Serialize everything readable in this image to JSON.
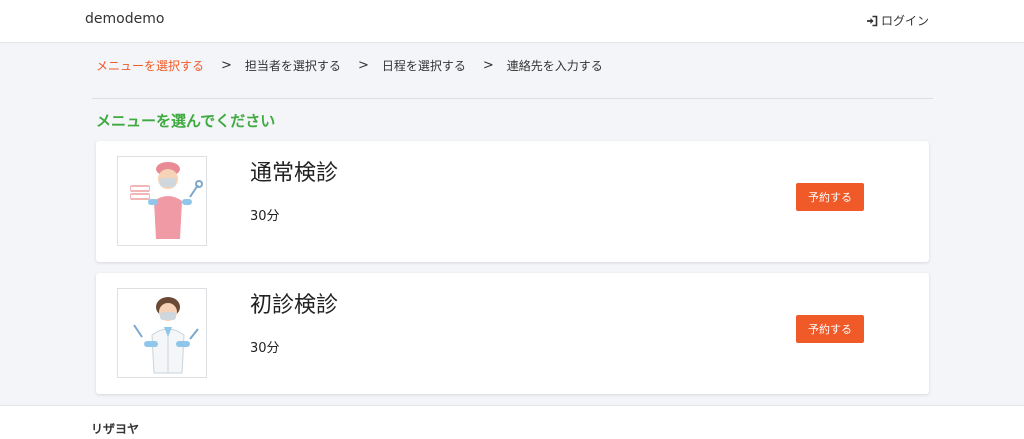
{
  "navbar": {
    "brand": "demodemo",
    "login_label": "ログイン",
    "login_icon": "sign-in-icon"
  },
  "steps": [
    {
      "label": "メニューを選択する",
      "active": true
    },
    {
      "label": "担当者を選択する",
      "active": false
    },
    {
      "label": "日程を選択する",
      "active": false
    },
    {
      "label": "連絡先を入力する",
      "active": false
    }
  ],
  "step_separator": ">",
  "heading": "メニューを選んでください",
  "menus": [
    {
      "name": "通常検診",
      "duration": "30分",
      "button_label": "予約する",
      "image": "dental-hygienist-illustration"
    },
    {
      "name": "初診検診",
      "duration": "30分",
      "button_label": "予約する",
      "image": "dentist-illustration"
    }
  ],
  "footer": {
    "text": "リザヨヤ"
  },
  "colors": {
    "accent": "#f05a29",
    "heading_green": "#3eaa3f",
    "background": "#f4f5f9"
  }
}
